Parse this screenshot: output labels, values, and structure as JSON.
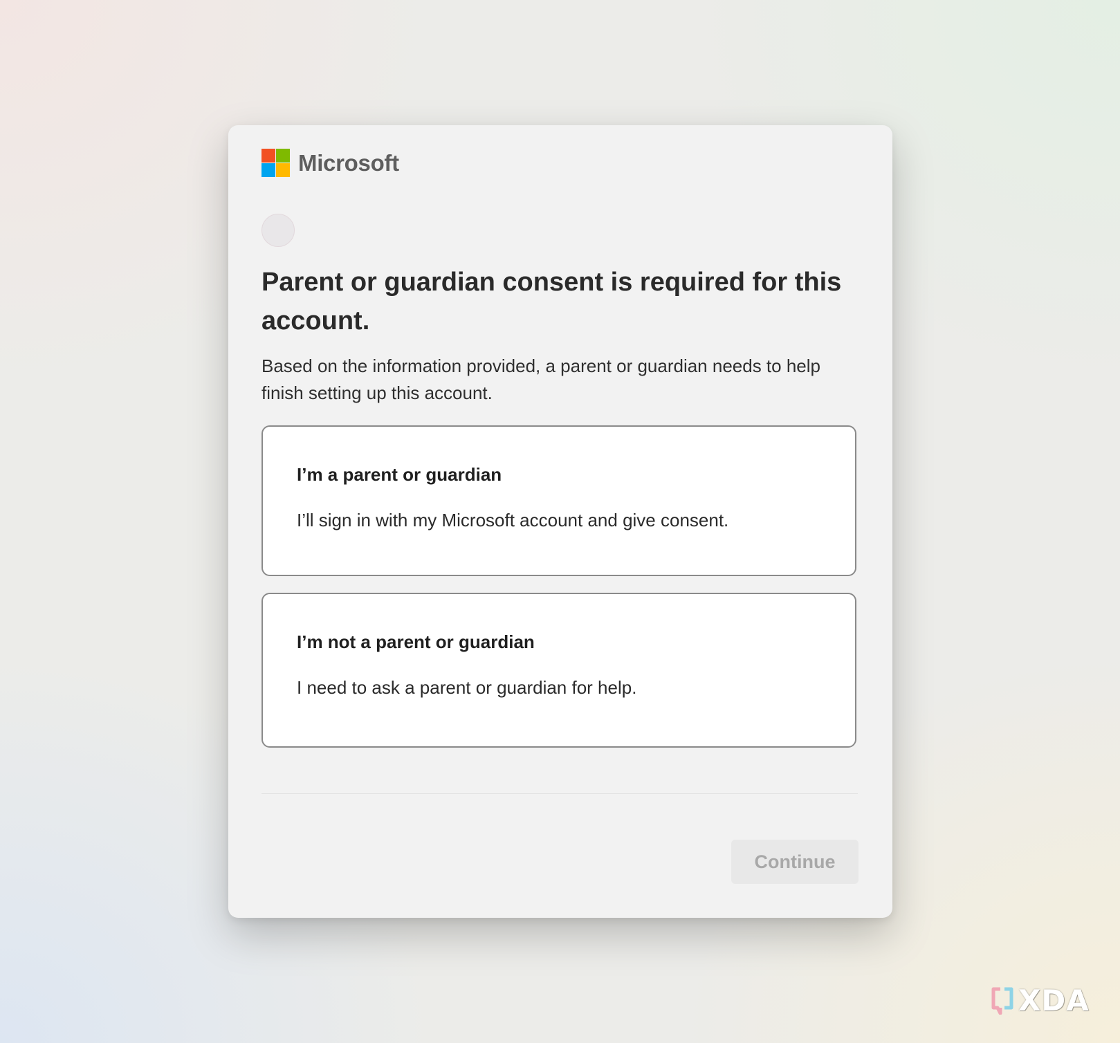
{
  "brand": {
    "name": "Microsoft",
    "logo_colors": [
      "#f25022",
      "#7fba00",
      "#00a4ef",
      "#ffb900"
    ]
  },
  "header": {
    "title": "Parent or guardian consent is required for this account.",
    "subtitle": "Based on the information provided, a parent or guardian needs to help finish setting up this account."
  },
  "options": [
    {
      "title": "I’m a parent or guardian",
      "description": "I’ll sign in with my Microsoft account and give consent."
    },
    {
      "title": "I’m not a parent or guardian",
      "description": "I need to ask a parent or guardian for help."
    }
  ],
  "footer": {
    "continue_label": "Continue",
    "continue_disabled": true
  },
  "watermark": {
    "text": "XDA",
    "icon": "xda-bracket-icon",
    "colors": [
      "#f0a7b5",
      "#8ed3e6"
    ]
  }
}
